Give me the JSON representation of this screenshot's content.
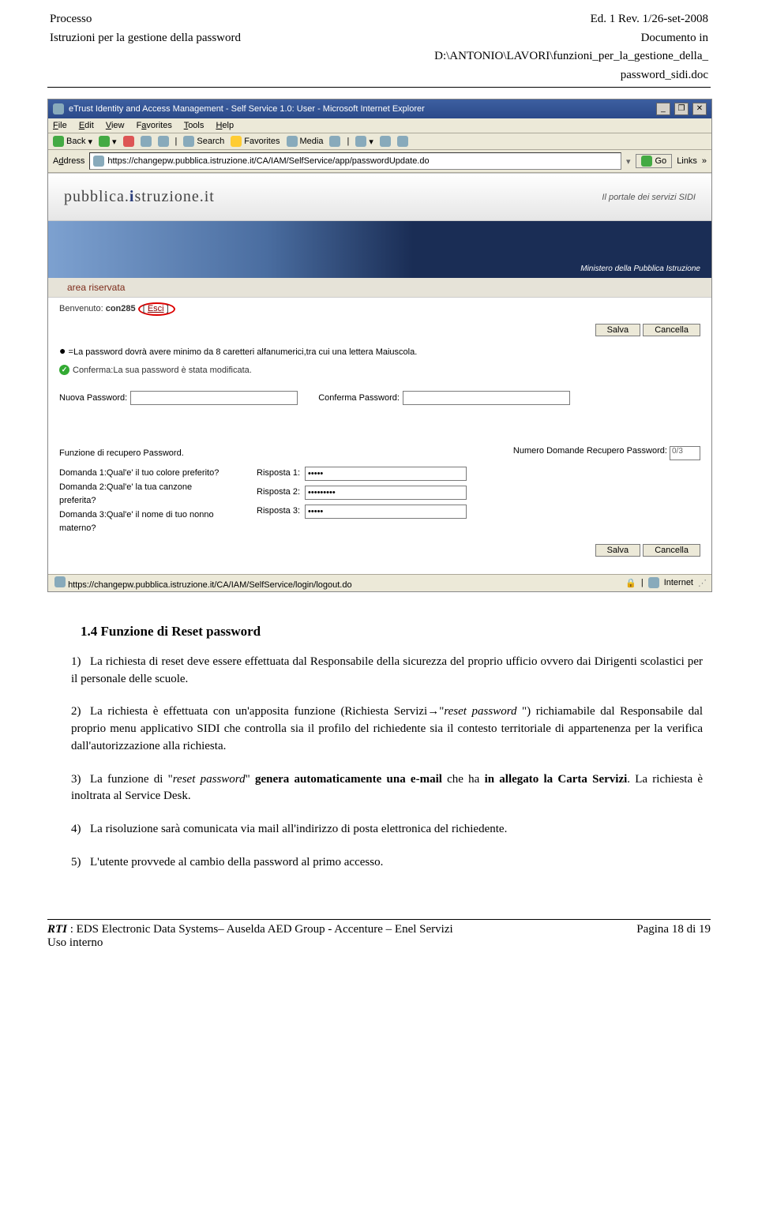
{
  "header": {
    "left1": "Processo",
    "left2": "Istruzioni per la gestione della password",
    "right1": "Ed. 1 Rev. 1/26-set-2008",
    "right2": "Documento in",
    "right3": "D:\\ANTONIO\\LAVORI\\funzioni_per_la_gestione_della_",
    "right4": "password_sidi.doc"
  },
  "browser": {
    "title": "eTrust Identity and Access Management - Self Service 1.0: User - Microsoft Internet Explorer",
    "menu": {
      "file": "File",
      "edit": "Edit",
      "view": "View",
      "fav": "Favorites",
      "tools": "Tools",
      "help": "Help"
    },
    "toolbar": {
      "back": "Back",
      "search": "Search",
      "favorites": "Favorites",
      "media": "Media"
    },
    "address_label": "Address",
    "url": "https://changepw.pubblica.istruzione.it/CA/IAM/SelfService/app/passwordUpdate.do",
    "go": "Go",
    "links_label": "Links",
    "status_url": "https://changepw.pubblica.istruzione.it/CA/IAM/SelfService/login/logout.do",
    "status_zone": "Internet"
  },
  "portal": {
    "brand_left": "pubblica.",
    "brand_mid": "i",
    "brand_right": "struzione.it",
    "brand_tag": "Il portale dei servizi SIDI",
    "hero_line1": "Ministero della Pubblica Istruzione",
    "area": "area riservata",
    "welcome": "Benvenuto: ",
    "user": "con285",
    "esci": "Esci",
    "save": "Salva",
    "cancel": "Cancella",
    "bullet": "=La password dovrà avere minimo da 8 caretteri alfanumerici,tra cui una lettera Maiuscola.",
    "confirm": "Conferma:La sua password è stata modificata.",
    "newpw_label": "Nuova Password:",
    "confpw_label": "Conferma Password:",
    "recover_title": "Funzione di recupero Password.",
    "numq_label": "Numero Domande Recupero Password:",
    "numq_value": "0/3",
    "q1": "Domanda 1:Qual'e' il tuo colore preferito?",
    "q2": "Domanda 2:Qual'e' la tua canzone preferita?",
    "q3": "Domanda 3:Qual'e' il nome di tuo nonno materno?",
    "r1": "Risposta 1:",
    "r2": "Risposta 2:",
    "r3": "Risposta 3:",
    "r1v": "•••••",
    "r2v": "•••••••••",
    "r3v": "•••••"
  },
  "body": {
    "heading": "1.4  Funzione di Reset password",
    "p1": "La richiesta di reset deve essere effettuata dal Responsabile della sicurezza del proprio ufficio ovvero dai Dirigenti scolastici per il personale delle scuole.",
    "p2_a": "La richiesta è effettuata con un'apposita funzione (Richiesta Servizi→\"",
    "p2_it": "reset password",
    "p2_b": " \") richiamabile dal Responsabile dal proprio menu applicativo SIDI che controlla sia il profilo del richiedente sia il contesto territoriale di appartenenza per la verifica dall'autorizzazione alla richiesta.",
    "p3_a": "La funzione di \"",
    "p3_it": "reset password",
    "p3_b": "\" ",
    "p3_bold": "genera automaticamente una e-mail",
    "p3_c": " che ha ",
    "p3_bold2": "in allegato la Carta Servizi",
    "p3_d": ". La richiesta è inoltrata al Service Desk.",
    "p4": "La risoluzione sarà comunicata via mail all'indirizzo di posta elettronica del richiedente.",
    "p5": "L'utente provvede al cambio della password  al primo accesso."
  },
  "footer": {
    "left1": "RTI",
    "left2": " : EDS Electronic Data Systems– Auselda AED Group - Accenture – Enel Servizi",
    "left3": "Uso interno",
    "right": "Pagina 18 di 19"
  }
}
